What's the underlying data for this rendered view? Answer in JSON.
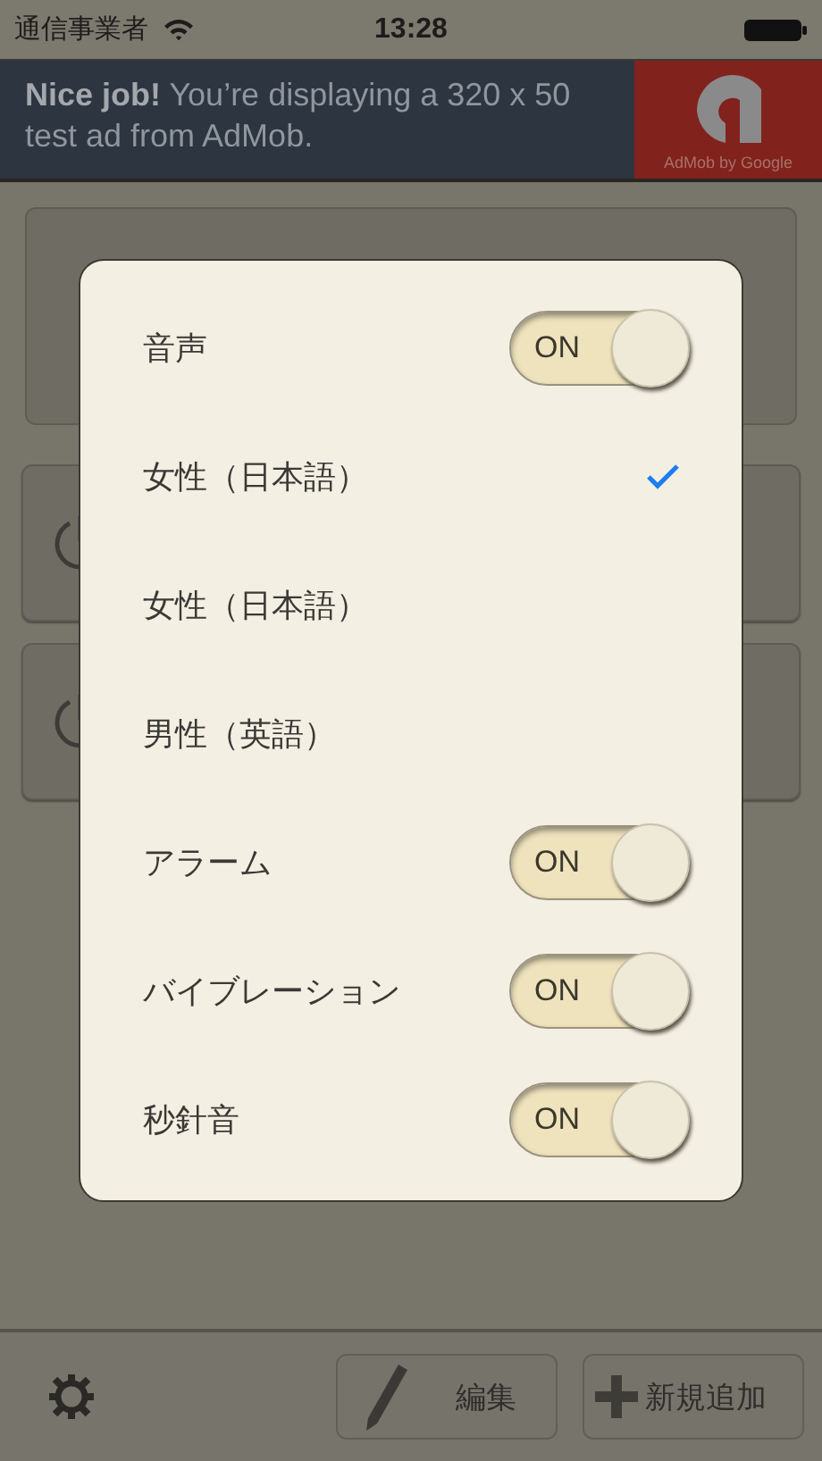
{
  "status_bar": {
    "carrier": "通信事業者",
    "time": "13:28"
  },
  "ad": {
    "text": "**Nice job!** You’re displaying a 320 x 50 test ad from AdMob.",
    "brand": "AdMob by Google"
  },
  "cards": [
    {
      "kind": "timer"
    },
    {
      "kind": "timer"
    }
  ],
  "settings": [
    {
      "kind": "toggle",
      "label": "音声",
      "on": true,
      "toggle_text": "ON"
    },
    {
      "kind": "option",
      "label": "女性（日本語）",
      "selected": true
    },
    {
      "kind": "option",
      "label": "女性（日本語）",
      "selected": false
    },
    {
      "kind": "option",
      "label": "男性（英語）",
      "selected": false
    },
    {
      "kind": "toggle",
      "label": "アラーム",
      "on": true,
      "toggle_text": "ON"
    },
    {
      "kind": "toggle",
      "label": "バイブレーション",
      "on": true,
      "toggle_text": "ON"
    },
    {
      "kind": "toggle",
      "label": "秒針音",
      "on": true,
      "toggle_text": "ON"
    }
  ],
  "toolbar": {
    "edit": "編集",
    "add": "新規追加"
  }
}
